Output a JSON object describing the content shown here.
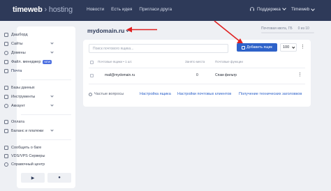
{
  "header": {
    "logo_main": "timeweb",
    "logo_sub": "hosting",
    "nav": [
      "Новости",
      "Есть идея",
      "Пригласи друга"
    ],
    "support": "Поддержка",
    "user": "Timeweb"
  },
  "sidebar": {
    "items": [
      {
        "label": "Дашборд",
        "icon": "dashboard-icon"
      },
      {
        "label": "Сайты",
        "icon": "sites-icon"
      },
      {
        "label": "Домены",
        "icon": "globe-icon"
      },
      {
        "label": "Файл. менеджер",
        "icon": "folder-icon",
        "badge": "NEW"
      },
      {
        "label": "Почта",
        "icon": "mail-icon"
      },
      {
        "label": "Базы данных",
        "icon": "database-icon"
      },
      {
        "label": "Инструменты",
        "icon": "tools-icon"
      },
      {
        "label": "Аккаунт",
        "icon": "account-icon"
      },
      {
        "label": "Оплата",
        "icon": "payment-icon"
      },
      {
        "label": "Баланс и платежи",
        "icon": "wallet-icon"
      },
      {
        "label": "Сообщить о баге",
        "icon": "bug-icon"
      },
      {
        "label": "VDS/VPS Серверы",
        "icon": "server-icon"
      },
      {
        "label": "Справочный центр",
        "icon": "help-icon"
      }
    ]
  },
  "main": {
    "domain": "mydomain.ru",
    "quota_label": "Почтовая квота, ГБ",
    "quota_value": "0 из 10",
    "search_placeholder": "Поиск почтового ящика...",
    "add_button": "Добавить ящик",
    "per_page": "100",
    "columns": [
      "Почтовые ящики • 1 шт.",
      "Занято места",
      "Почтовые функции"
    ],
    "row": {
      "email": "mail@mydomain.ru",
      "used": "0",
      "feature": "Спам фильтр"
    },
    "links": {
      "faq": "Частые вопросы",
      "settings": "Настройка ящика",
      "clients": "Настройки почтовых клиентов",
      "headers": "Получение технических заголовков"
    }
  },
  "colors": {
    "topbar": "#2e3a59",
    "accent": "#2e62c9",
    "annotation_arrow": "#e02020"
  }
}
